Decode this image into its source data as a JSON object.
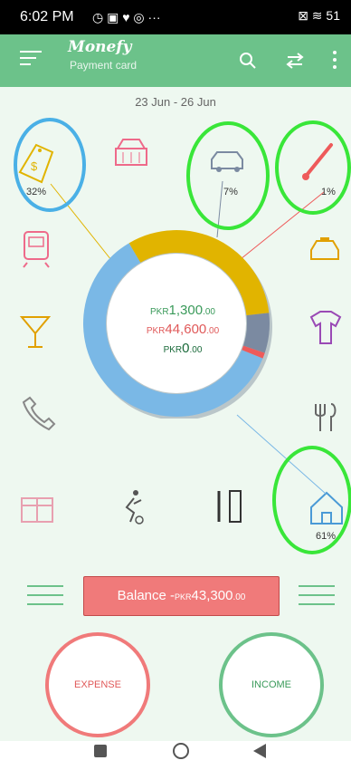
{
  "status": {
    "time": "6:02 PM",
    "icons_left": "◷ ▣ ♥ ◎ ···",
    "icons_right": "⊠ ≋ 51"
  },
  "header": {
    "title": "Monefy",
    "subtitle": "Payment card"
  },
  "date_range": "23 Jun - 26 Jun",
  "categories": {
    "top_left": {
      "icon": "price-tag-icon",
      "percent": "32%"
    },
    "top_car": {
      "icon": "car-icon",
      "percent": "7%"
    },
    "top_right": {
      "icon": "thermometer-icon",
      "percent": "1%"
    },
    "bottom_right": {
      "icon": "house-icon",
      "percent": "61%"
    }
  },
  "summary": {
    "income_currency": "PKR",
    "income_amount": "1,300",
    "income_cents": ".00",
    "expense_currency": "PKR",
    "expense_amount": "44,600",
    "expense_cents": ".00",
    "other_currency": "PKR",
    "other_amount": "0",
    "other_cents": ".00"
  },
  "balance": {
    "label": "Balance",
    "sign": "-",
    "currency": "PKR",
    "amount": "43,300",
    "cents": ".00"
  },
  "buttons": {
    "expense": "EXPENSE",
    "income": "INCOME"
  },
  "colors": {
    "app_bar": "#6cc28a",
    "background": "#eef8f0",
    "expense": "#f07a7a",
    "income": "#6cc28a",
    "home": "#7ab8e6",
    "tag": "#e1b400",
    "car": "#7b8aa1",
    "health": "#ee5a5a"
  },
  "chart_data": {
    "type": "pie",
    "categories": [
      "House",
      "Tag",
      "Car",
      "Health"
    ],
    "values": [
      61,
      32,
      7,
      1
    ]
  }
}
